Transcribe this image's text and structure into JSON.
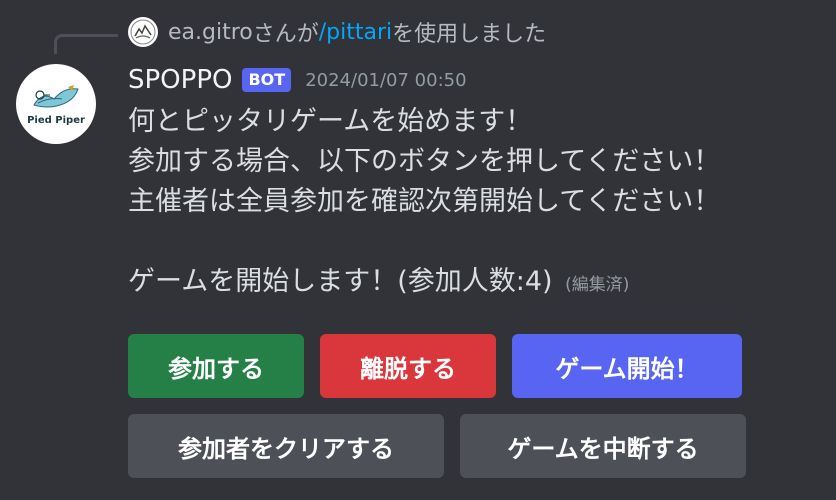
{
  "reply": {
    "user": "ea.gitro",
    "middle_text": "さんが",
    "command": "/pittari",
    "suffix_text": "を使用しました"
  },
  "message": {
    "avatar_logo_text": "Pied Piper",
    "username": "SPOPPO",
    "badge": "BOT",
    "timestamp": "2024/01/07 00:50",
    "lines": [
      "何とピッタリゲームを始めます！",
      "参加する場合、以下のボタンを押してください！",
      "主催者は全員参加を確認次第開始してください！"
    ],
    "status_line": "ゲームを開始します！(参加人数:4)",
    "edited_label": "(編集済)"
  },
  "buttons": {
    "join": "参加する",
    "leave": "離脱する",
    "start": "ゲーム開始！",
    "clear": "参加者をクリアする",
    "abort": "ゲームを中断する"
  },
  "colors": {
    "background": "#313338",
    "join": "#248046",
    "leave": "#da373c",
    "start": "#5865f2",
    "secondary": "#4e5058",
    "link": "#00a8fc"
  }
}
